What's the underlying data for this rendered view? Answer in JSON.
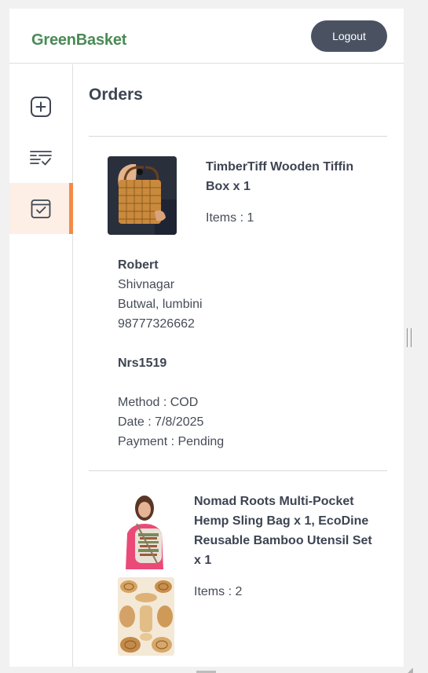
{
  "header": {
    "brand": "GreenBasket",
    "logout_label": "Logout"
  },
  "sidebar": {
    "items": [
      {
        "icon": "add-square-icon",
        "active": false
      },
      {
        "icon": "list-check-icon",
        "active": false
      },
      {
        "icon": "calendar-check-icon",
        "active": true
      }
    ],
    "accent": "#f28a46"
  },
  "main": {
    "title": "Orders",
    "orders": [
      {
        "product_name": "TimberTiff Wooden Tiffin Box x 1",
        "items": "Items : 1",
        "customer_name": "Robert",
        "street": "Shivnagar",
        "city": "Butwal, lumbini",
        "phone": "98777326662",
        "amount": "Nrs1519",
        "method": "Method : COD",
        "date": "Date : 7/8/2025",
        "payment": "Payment : Pending"
      },
      {
        "product_name": "Nomad Roots Multi-Pocket Hemp Sling Bag x 1, EcoDine Reusable Bamboo Utensil Set x 1",
        "items": "Items : 2"
      }
    ]
  },
  "colors": {
    "brand": "#4a8a55",
    "logout_bg": "#4a5262",
    "active_bg": "#fdefe6"
  }
}
